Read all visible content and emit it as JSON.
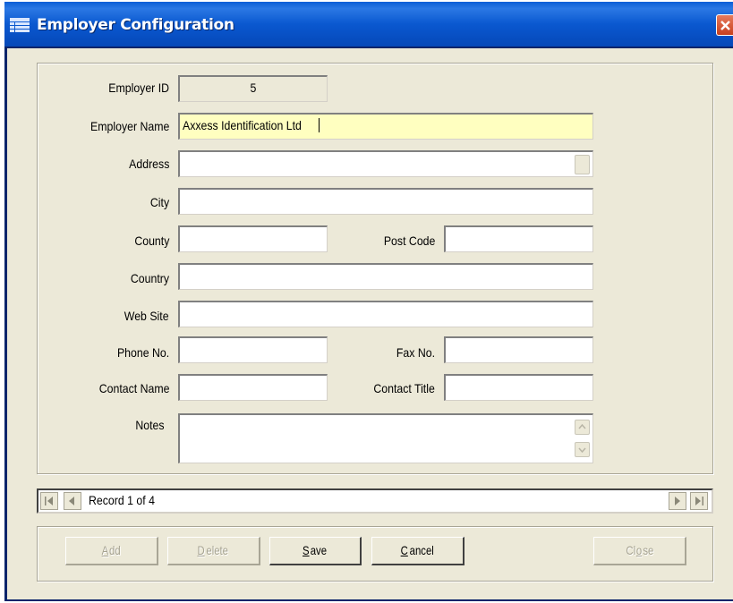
{
  "window": {
    "title": "Employer Configuration"
  },
  "form": {
    "employer_id": {
      "label": "Employer ID",
      "value": "5"
    },
    "employer_name": {
      "label": "Employer Name",
      "value": "Axxess Identification Ltd"
    },
    "address": {
      "label": "Address",
      "value": ""
    },
    "city": {
      "label": "City",
      "value": ""
    },
    "county": {
      "label": "County",
      "value": ""
    },
    "post_code": {
      "label": "Post Code",
      "value": ""
    },
    "country": {
      "label": "Country",
      "value": ""
    },
    "web_site": {
      "label": "Web Site",
      "value": ""
    },
    "phone": {
      "label": "Phone No.",
      "value": ""
    },
    "fax": {
      "label": "Fax No.",
      "value": ""
    },
    "contact_name": {
      "label": "Contact Name",
      "value": ""
    },
    "contact_title": {
      "label": "Contact Title",
      "value": ""
    },
    "notes": {
      "label": "Notes",
      "value": ""
    }
  },
  "navigator": {
    "record_text": "Record 1 of 4"
  },
  "buttons": {
    "add": {
      "accel": "A",
      "rest": "dd",
      "enabled": false
    },
    "delete": {
      "accel": "D",
      "rest": "elete",
      "enabled": false
    },
    "save": {
      "accel": "S",
      "rest": "ave",
      "enabled": true
    },
    "cancel": {
      "accel": "C",
      "rest": "ancel",
      "enabled": true
    },
    "close": {
      "pre": "Cl",
      "accel": "o",
      "rest": "se",
      "enabled": false
    }
  },
  "colors": {
    "titlebar": "#0a58d0",
    "window_bg": "#ece9d8",
    "highlight_field": "#ffffc0",
    "close_button": "#d4532e"
  },
  "icons": {
    "app": "grid-window-icon",
    "close": "close-icon",
    "nav_first": "first-record-icon",
    "nav_prev": "previous-record-icon",
    "nav_next": "next-record-icon",
    "nav_last": "last-record-icon"
  }
}
